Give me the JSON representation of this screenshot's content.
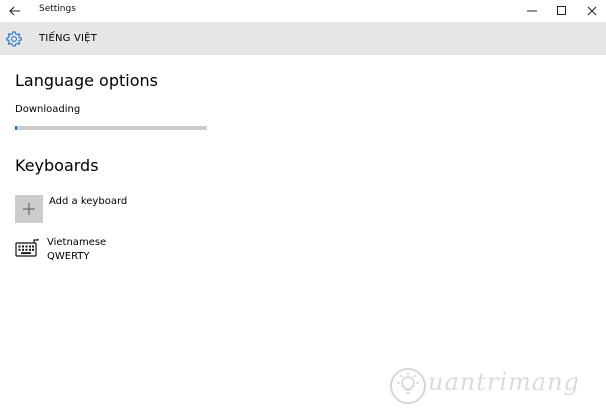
{
  "window": {
    "title": "Settings",
    "controls": [
      "minimize",
      "maximize",
      "close"
    ]
  },
  "header": {
    "icon": "gear-icon",
    "title": "TIẾNG VIỆT"
  },
  "language_options": {
    "heading": "Language options",
    "status": "Downloading",
    "progress": 0.01
  },
  "keyboards": {
    "heading": "Keyboards",
    "add_label": "Add a keyboard",
    "items": [
      {
        "name": "Vietnamese",
        "layout": "QWERTY",
        "icon": "keyboard-icon"
      }
    ]
  },
  "watermark": {
    "text": "uantrimang"
  },
  "colors": {
    "accent": "#0078d7",
    "header_bg": "#e6e6e6",
    "button_bg": "#cccccc"
  }
}
